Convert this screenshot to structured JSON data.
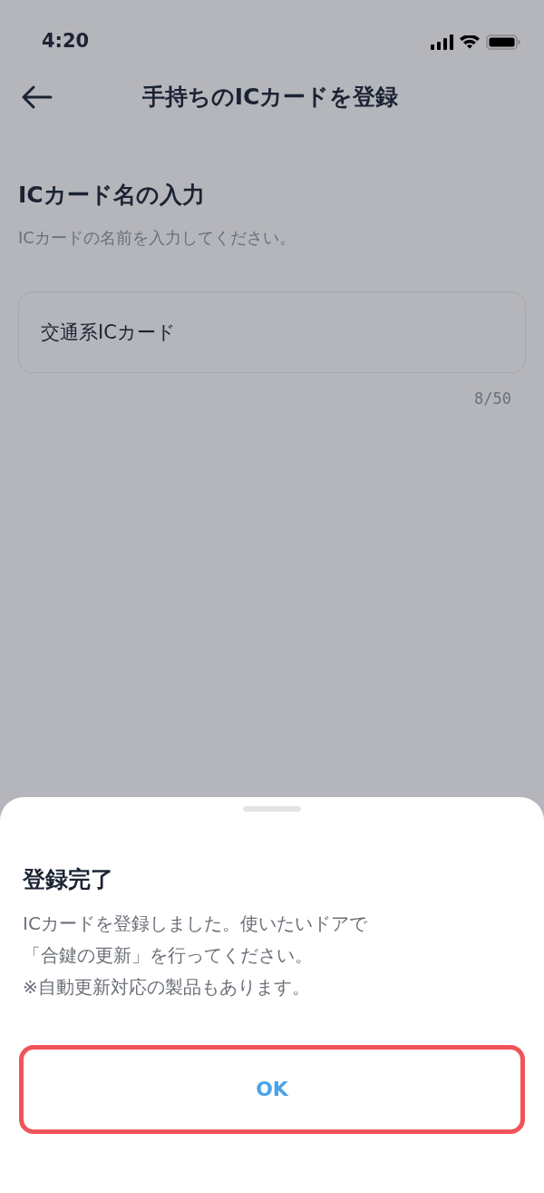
{
  "status_bar": {
    "time": "4:20"
  },
  "nav": {
    "title": "手持ちのICカードを登録"
  },
  "section": {
    "title": "ICカード名の入力",
    "hint": "ICカードの名前を入力してください。"
  },
  "name_field": {
    "value": "交通系ICカード",
    "counter": "8/50"
  },
  "sheet": {
    "title": "登録完了",
    "message_lines": [
      "ICカードを登録しました。使いたいドアで",
      "「合鍵の更新」を行ってください。",
      "※自動更新対応の製品もあります。"
    ],
    "button": {
      "label": "OK",
      "highlighted": true
    }
  }
}
